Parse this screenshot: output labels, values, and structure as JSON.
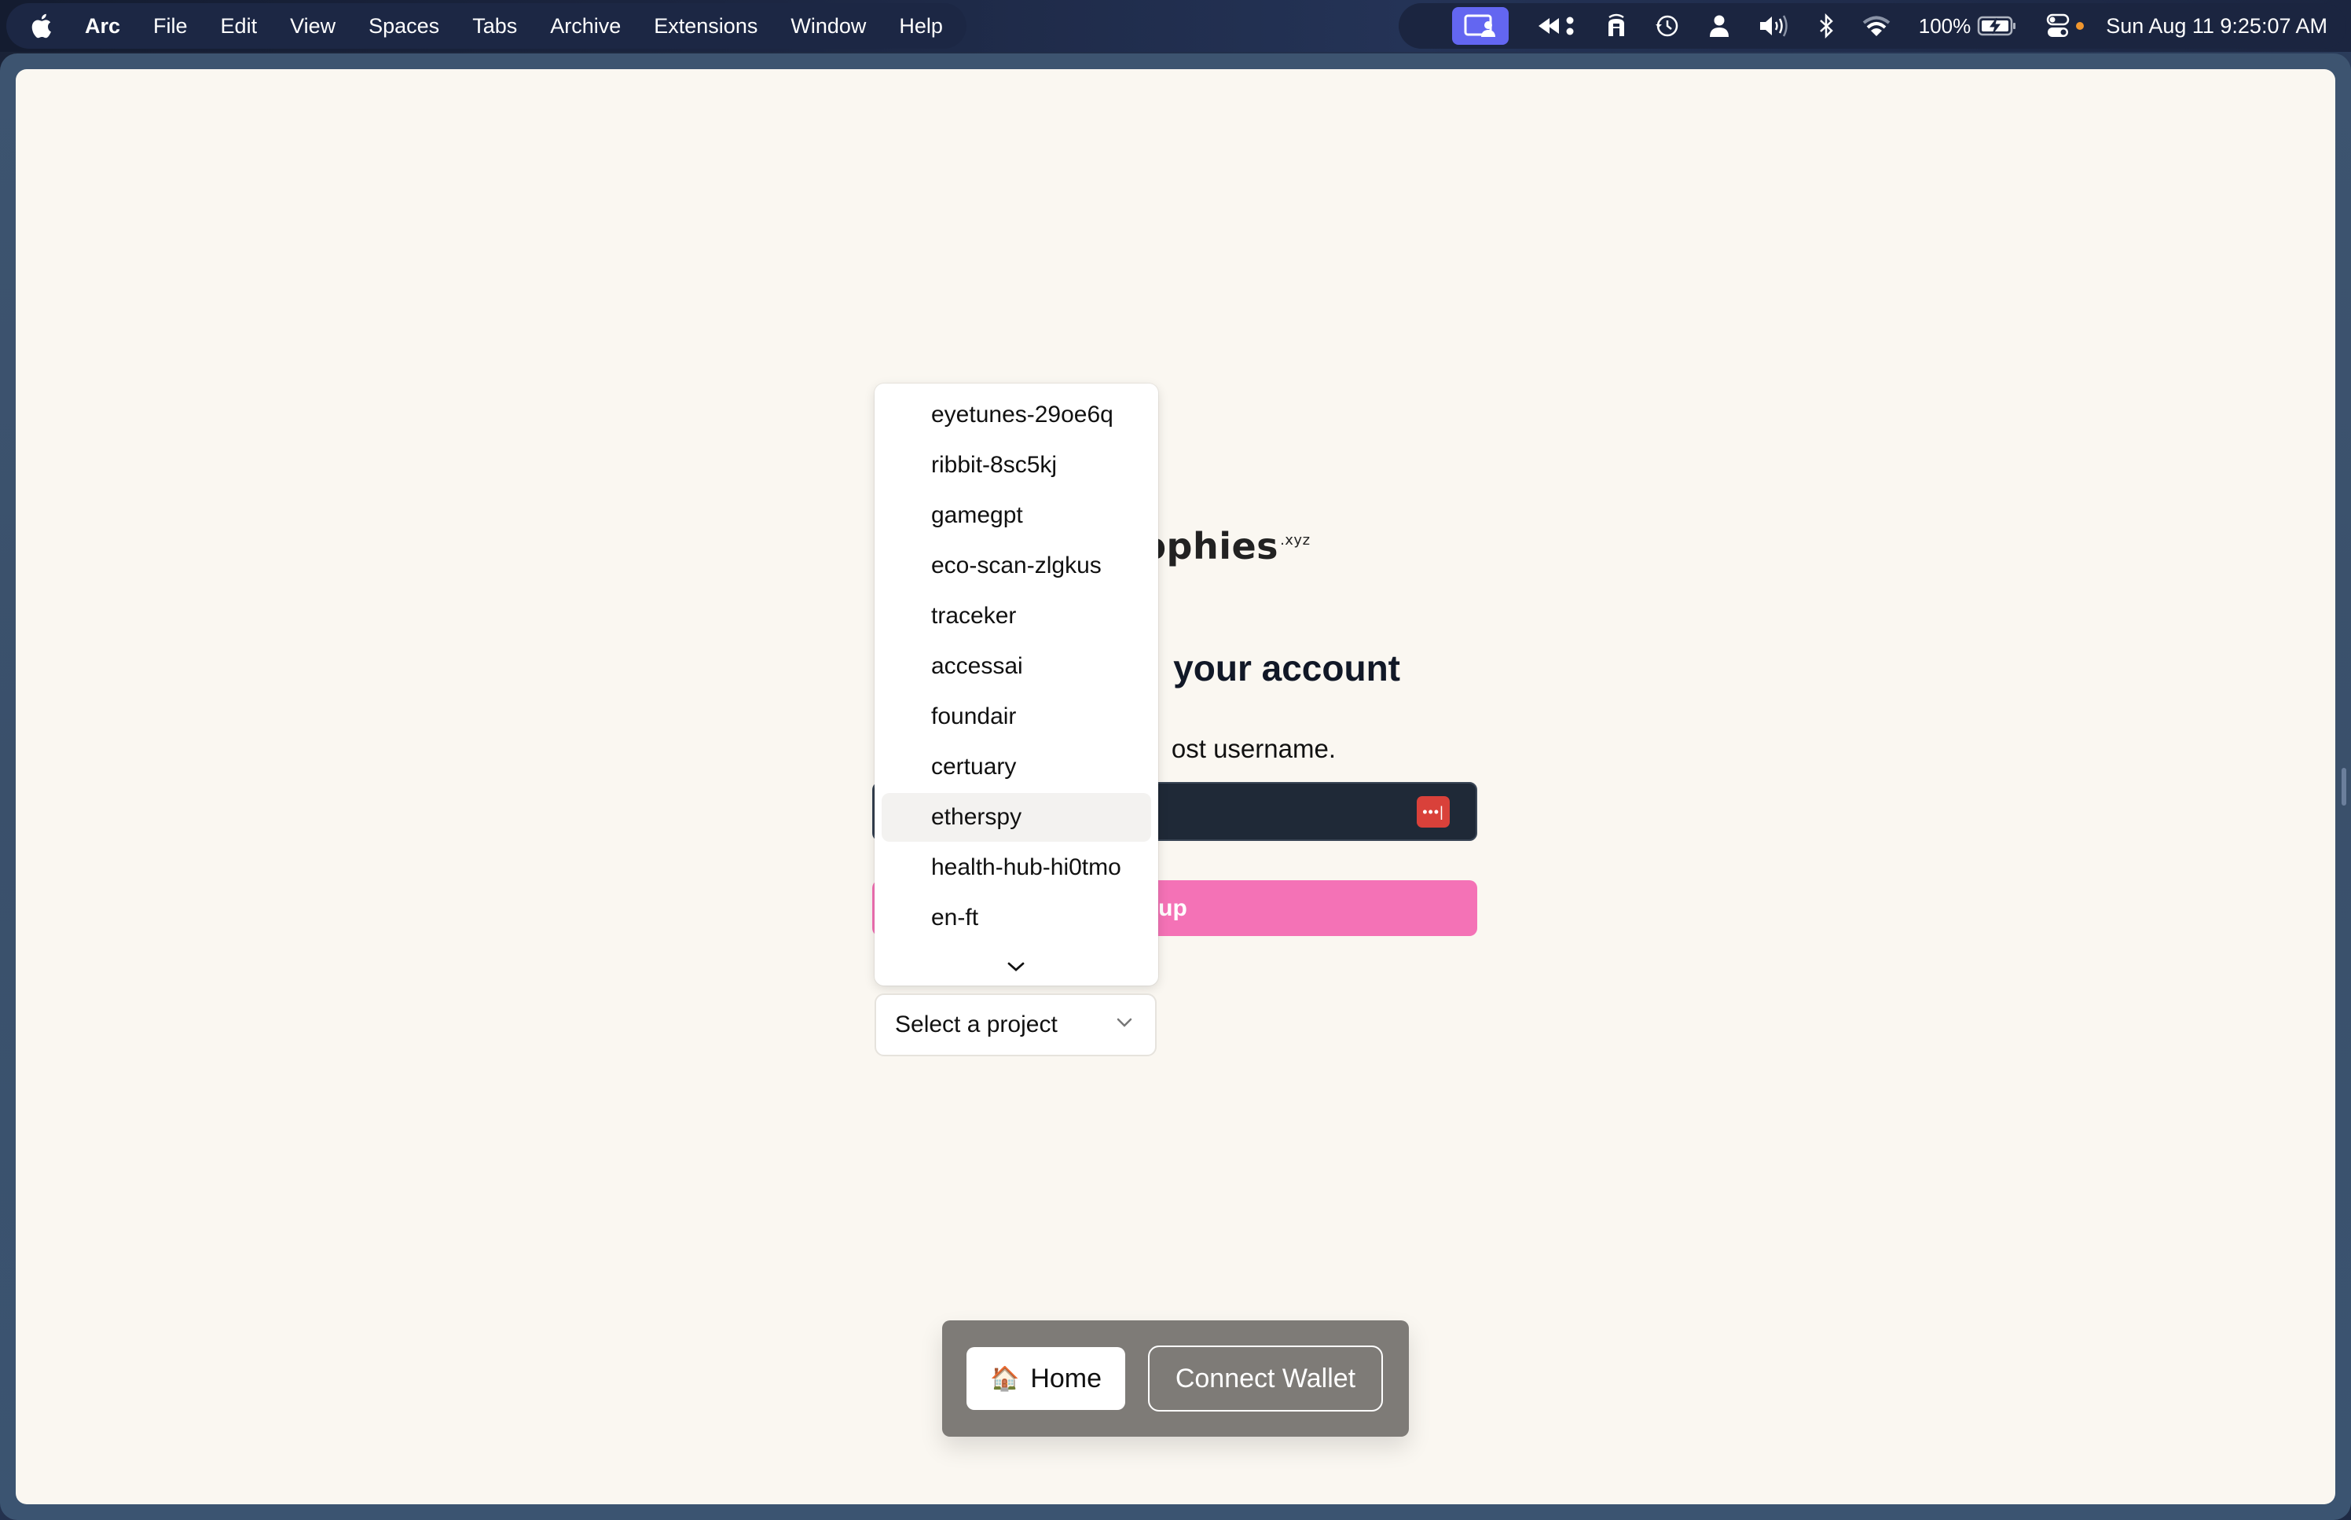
{
  "menubar": {
    "app_name": "Arc",
    "items": [
      "File",
      "Edit",
      "View",
      "Spaces",
      "Tabs",
      "Archive",
      "Extensions",
      "Window",
      "Help"
    ],
    "status": {
      "icons": [
        "screen-share-icon",
        "rewind-icon",
        "helmet-icon",
        "time-machine-icon",
        "user-icon",
        "volume-icon",
        "bluetooth-icon",
        "wifi-icon"
      ],
      "battery_percent": "100%",
      "battery_charging": true,
      "datetime": "Sun Aug 11  9:25:07 AM"
    }
  },
  "page": {
    "logo": {
      "visible_text": "ophies",
      "suffix": ".xyz"
    },
    "heading_visible": "your account",
    "subtitle_visible": "ost username.",
    "username_input": {
      "value": "",
      "password_manager_icon": "•••|"
    },
    "signup_button_visible": "gn up",
    "colors": {
      "background": "#faf7f1",
      "input_bg": "#1f2937",
      "signup_bg": "#f472b6",
      "pw_manager": "#d9413a",
      "highlight_row": "#f3f2f0"
    }
  },
  "project_select": {
    "value": "Select a project",
    "options": [
      "eyetunes-29oe6q",
      "ribbit-8sc5kj",
      "gamegpt",
      "eco-scan-zlgkus",
      "traceker",
      "accessai",
      "foundair",
      "certuary",
      "etherspy",
      "health-hub-hi0tmo",
      "en-ft"
    ],
    "highlighted_index": 8,
    "has_more_below": true
  },
  "bottom_nav": {
    "home_emoji": "🏠",
    "home_label": "Home",
    "wallet_label": "Connect Wallet"
  }
}
